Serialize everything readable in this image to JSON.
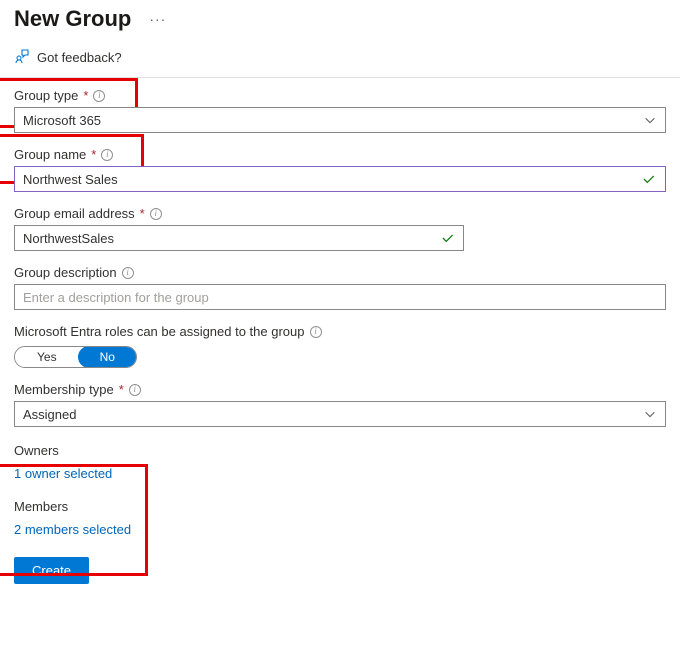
{
  "header": {
    "title": "New Group",
    "more": "···"
  },
  "feedback": {
    "label": "Got feedback?"
  },
  "fields": {
    "group_type": {
      "label": "Group type",
      "value": "Microsoft 365"
    },
    "group_name": {
      "label": "Group name",
      "value": "Northwest Sales"
    },
    "group_email": {
      "label": "Group email address",
      "value": "NorthwestSales"
    },
    "description": {
      "label": "Group description",
      "placeholder": "Enter a description for the group"
    },
    "roles_assign": {
      "label": "Microsoft Entra roles can be assigned to the group",
      "yes": "Yes",
      "no": "No"
    },
    "membership_type": {
      "label": "Membership type",
      "value": "Assigned"
    }
  },
  "owners": {
    "label": "Owners",
    "link": "1 owner selected"
  },
  "members": {
    "label": "Members",
    "link": "2 members selected"
  },
  "create_button": "Create",
  "required_marker": "*"
}
